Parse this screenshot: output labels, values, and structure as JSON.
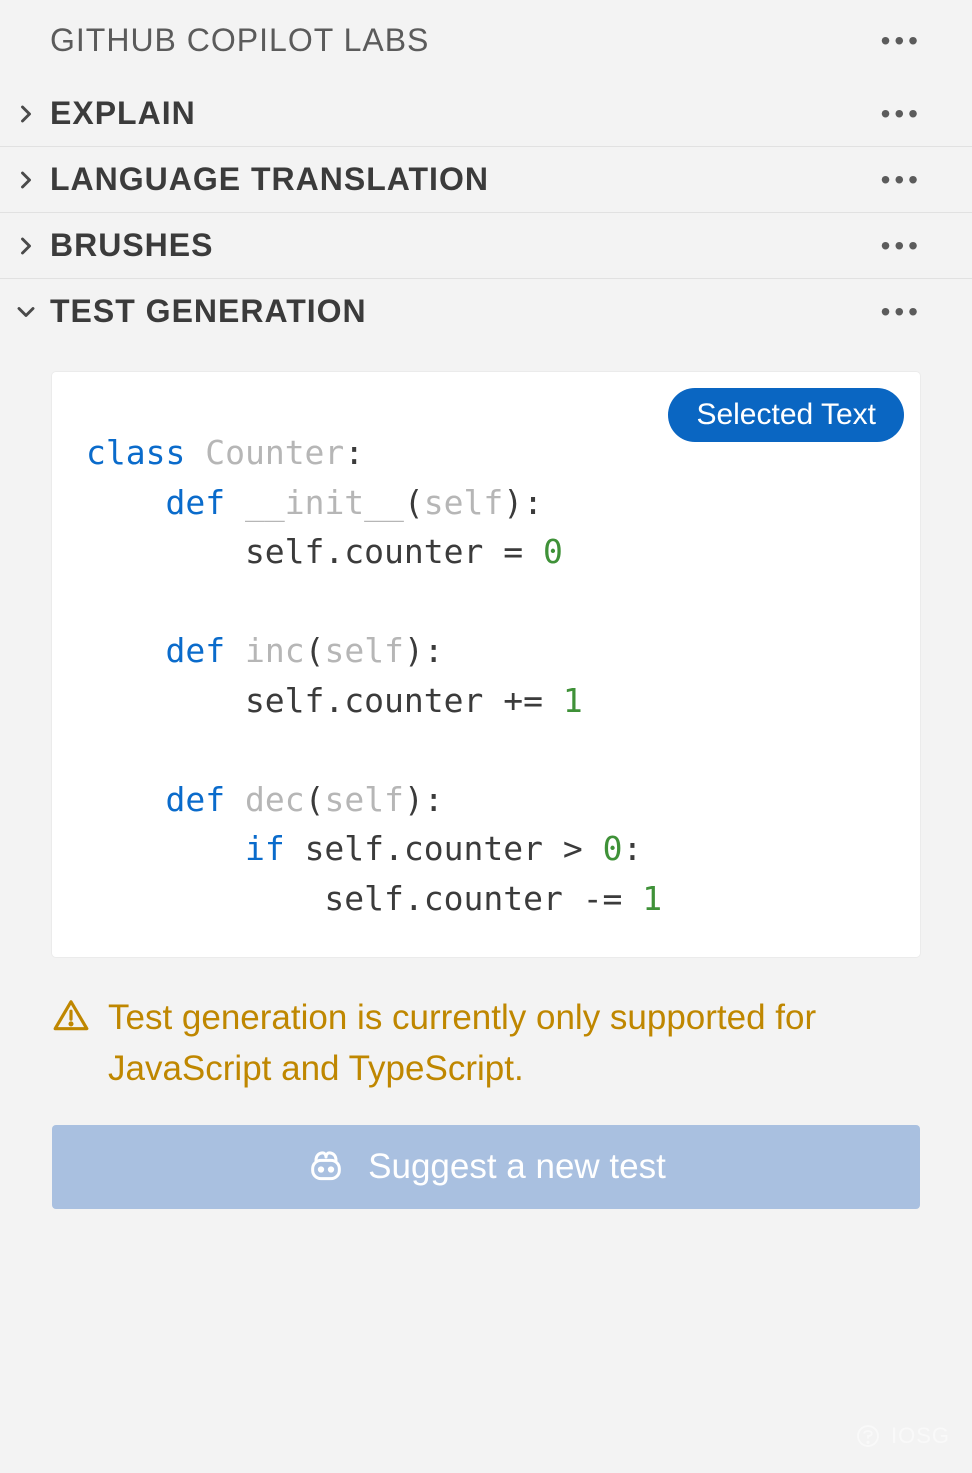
{
  "panel": {
    "title": "GITHUB COPILOT LABS"
  },
  "sections": {
    "explain": {
      "label": "EXPLAIN",
      "expanded": false
    },
    "translate": {
      "label": "LANGUAGE TRANSLATION",
      "expanded": false
    },
    "brushes": {
      "label": "BRUSHES",
      "expanded": false
    },
    "testgen": {
      "label": "TEST GENERATION",
      "expanded": true
    }
  },
  "testgen": {
    "badge": "Selected Text",
    "code": {
      "lines": [
        [
          {
            "t": "class ",
            "c": "kw"
          },
          {
            "t": "Counter",
            "c": "name"
          },
          {
            "t": ":",
            "c": ""
          }
        ],
        [
          {
            "t": "    ",
            "c": ""
          },
          {
            "t": "def ",
            "c": "kw"
          },
          {
            "t": "__init__",
            "c": "name"
          },
          {
            "t": "(",
            "c": ""
          },
          {
            "t": "self",
            "c": "name"
          },
          {
            "t": "):",
            "c": ""
          }
        ],
        [
          {
            "t": "        self.counter = ",
            "c": ""
          },
          {
            "t": "0",
            "c": "num"
          }
        ],
        [
          {
            "t": "",
            "c": ""
          }
        ],
        [
          {
            "t": "    ",
            "c": ""
          },
          {
            "t": "def ",
            "c": "kw"
          },
          {
            "t": "inc",
            "c": "name"
          },
          {
            "t": "(",
            "c": ""
          },
          {
            "t": "self",
            "c": "name"
          },
          {
            "t": "):",
            "c": ""
          }
        ],
        [
          {
            "t": "        self.counter += ",
            "c": ""
          },
          {
            "t": "1",
            "c": "num"
          }
        ],
        [
          {
            "t": "",
            "c": ""
          }
        ],
        [
          {
            "t": "    ",
            "c": ""
          },
          {
            "t": "def ",
            "c": "kw"
          },
          {
            "t": "dec",
            "c": "name"
          },
          {
            "t": "(",
            "c": ""
          },
          {
            "t": "self",
            "c": "name"
          },
          {
            "t": "):",
            "c": ""
          }
        ],
        [
          {
            "t": "        ",
            "c": ""
          },
          {
            "t": "if ",
            "c": "kw"
          },
          {
            "t": "self.counter > ",
            "c": ""
          },
          {
            "t": "0",
            "c": "num"
          },
          {
            "t": ":",
            "c": ""
          }
        ],
        [
          {
            "t": "            self.counter -= ",
            "c": ""
          },
          {
            "t": "1",
            "c": "num"
          }
        ]
      ]
    },
    "warning": "Test generation is currently only supported for JavaScript and TypeScript.",
    "button": "Suggest a new test"
  },
  "watermark": "IOSG"
}
